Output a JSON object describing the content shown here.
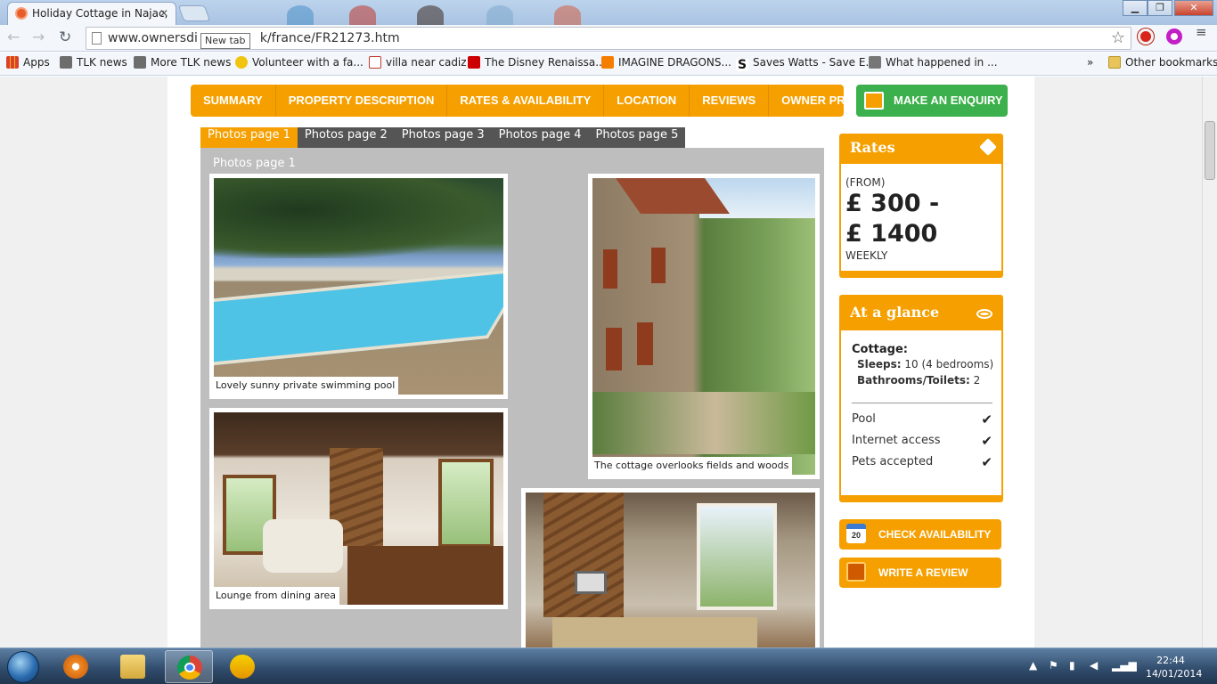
{
  "browser": {
    "tab_title": "Holiday Cottage in Najac,",
    "tab_close": "✕",
    "url_visible_start": "www.ownersdi",
    "url_visible_end": "k/france/FR21273.htm",
    "tooltip": "New tab",
    "window_buttons": [
      "▁",
      "❐",
      "✕"
    ]
  },
  "bookmarks": [
    {
      "label": "Apps",
      "color": "#d9412b"
    },
    {
      "label": "TLK news",
      "color": "#6d6d6d"
    },
    {
      "label": "More TLK news",
      "color": "#6d6d6d"
    },
    {
      "label": "Volunteer with a fa...",
      "color": "#f1c40f"
    },
    {
      "label": "villa near cadiz",
      "color": "#c0392b"
    },
    {
      "label": "The Disney Renaissa...",
      "color": "#cc0000"
    },
    {
      "label": "IMAGINE DRAGONS...",
      "color": "#f57d00"
    },
    {
      "label": "Saves Watts - Save E...",
      "color": "#111111"
    },
    {
      "label": "What happened in ...",
      "color": "#777777"
    }
  ],
  "bookmarks_overflow": "»",
  "other_bookmarks": "Other bookmarks",
  "nav": {
    "tabs": [
      "SUMMARY",
      "PROPERTY DESCRIPTION",
      "RATES & AVAILABILITY",
      "LOCATION",
      "REVIEWS",
      "OWNER PROFILE"
    ],
    "enquiry": "MAKE AN ENQUIRY"
  },
  "gallery": {
    "tabs": [
      "Photos page 1",
      "Photos page 2",
      "Photos page 3",
      "Photos page 4",
      "Photos page 5"
    ],
    "heading": "Photos page 1",
    "captions": [
      "Lovely sunny private swimming pool",
      "The cottage overlooks fields and woods",
      "Lounge from dining area"
    ]
  },
  "rates": {
    "title": "Rates",
    "from": "(FROM)",
    "amount": "£ 300 -\n£ 1400",
    "period": "WEEKLY"
  },
  "glance": {
    "title": "At a glance",
    "type": "Cottage:",
    "sleeps_label": "Sleeps:",
    "sleeps_value": "10 (4 bedrooms)",
    "bath_label": "Bathrooms/Toilets:",
    "bath_value": "2",
    "features": [
      "Pool",
      "Internet access",
      "Pets accepted"
    ],
    "check": "✔"
  },
  "buttons": {
    "check_availability": "CHECK AVAILABILITY",
    "calendar_day": "20",
    "write_review": "WRITE A REVIEW"
  },
  "taskbar": {
    "time": "22:44",
    "date": "14/01/2014"
  }
}
